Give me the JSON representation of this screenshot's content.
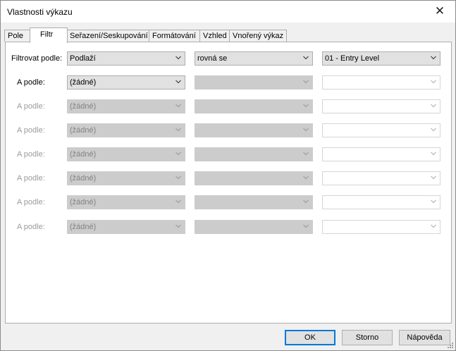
{
  "window": {
    "title": "Vlastnosti výkazu"
  },
  "tabs": [
    {
      "label": "Pole"
    },
    {
      "label": "Filtr"
    },
    {
      "label": "Seřazení/Seskupování"
    },
    {
      "label": "Formátování"
    },
    {
      "label": "Vzhled"
    },
    {
      "label": "Vnořený výkaz"
    }
  ],
  "filter": {
    "row0": {
      "label": "Filtrovat podle:",
      "field": "Podlaží",
      "operator": "rovná se",
      "value": "01 - Entry Level"
    },
    "row1": {
      "label": "A podle:",
      "field": "(žádné)",
      "operator": "",
      "value": ""
    },
    "row2": {
      "label": "A podle:",
      "field": "(žádné)",
      "operator": "",
      "value": ""
    },
    "row3": {
      "label": "A podle:",
      "field": "(žádné)",
      "operator": "",
      "value": ""
    },
    "row4": {
      "label": "A podle:",
      "field": "(žádné)",
      "operator": "",
      "value": ""
    },
    "row5": {
      "label": "A podle:",
      "field": "(žádné)",
      "operator": "",
      "value": ""
    },
    "row6": {
      "label": "A podle:",
      "field": "(žádné)",
      "operator": "",
      "value": ""
    },
    "row7": {
      "label": "A podle:",
      "field": "(žádné)",
      "operator": "",
      "value": ""
    }
  },
  "buttons": {
    "ok": "OK",
    "cancel": "Storno",
    "help": "Nápověda"
  },
  "colors": {
    "accent": "#0078d7",
    "disabled_fill": "#cccccc",
    "disabled_text": "#9a9a9a"
  },
  "icons": {
    "close": "close-icon",
    "dropdown": "chevron-down-icon",
    "resize": "resize-grip-icon"
  }
}
